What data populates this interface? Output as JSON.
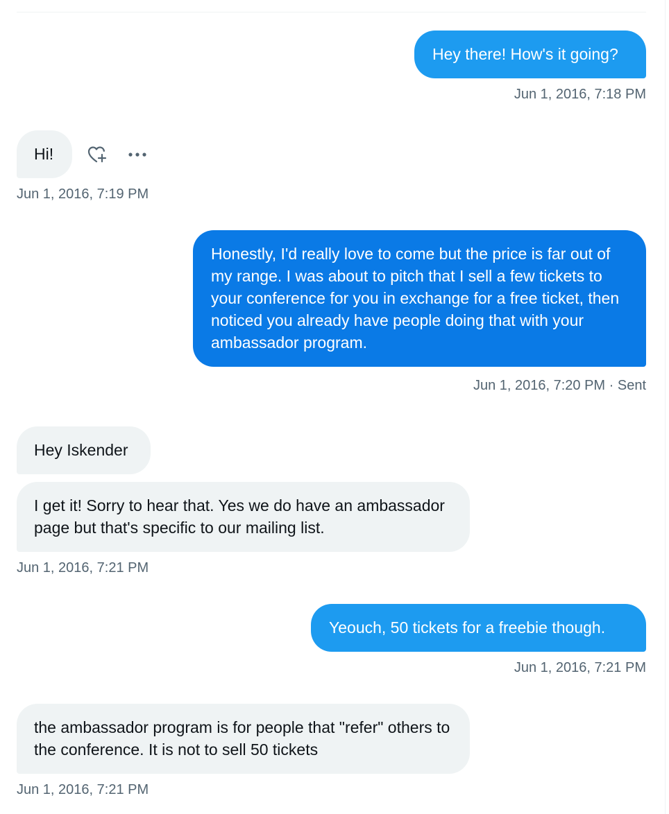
{
  "conversation": {
    "messages": [
      {
        "direction": "sent",
        "text": "Hey there! How's it going?",
        "timestamp": "Jun 1, 2016, 7:18 PM"
      },
      {
        "direction": "received",
        "text": "Hi!",
        "timestamp": "Jun 1, 2016, 7:19 PM"
      },
      {
        "direction": "sent",
        "text": "Honestly, I'd really love to come but the price is far out of my range. I was about to pitch that I sell a few tickets to your conference for you in exchange for a free ticket, then noticed you already have people doing that with your ambassador program.",
        "timestamp": "Jun 1, 2016, 7:20 PM · Sent"
      },
      {
        "direction": "received",
        "text": "Hey Iskender",
        "timestamp": ""
      },
      {
        "direction": "received",
        "text": "I get it! Sorry to hear that. Yes we do have an ambassador page but that's specific to our mailing list.",
        "timestamp": "Jun 1, 2016, 7:21 PM"
      },
      {
        "direction": "sent",
        "text": "Yeouch, 50 tickets for a freebie though.",
        "timestamp": "Jun 1, 2016, 7:21 PM"
      },
      {
        "direction": "received",
        "text": "the ambassador program is for people that \"refer\" others to the conference. It is not to sell 50 tickets",
        "timestamp": "Jun 1, 2016, 7:21 PM"
      }
    ],
    "hover_actions": {
      "icons": [
        "heart-plus-icon",
        "more-icon"
      ]
    }
  },
  "colors": {
    "sent_bubble": "#1d9bf0",
    "sent_bubble_selected": "#0a7ae6",
    "received_bubble": "#eff3f4",
    "timestamp": "#536471"
  }
}
